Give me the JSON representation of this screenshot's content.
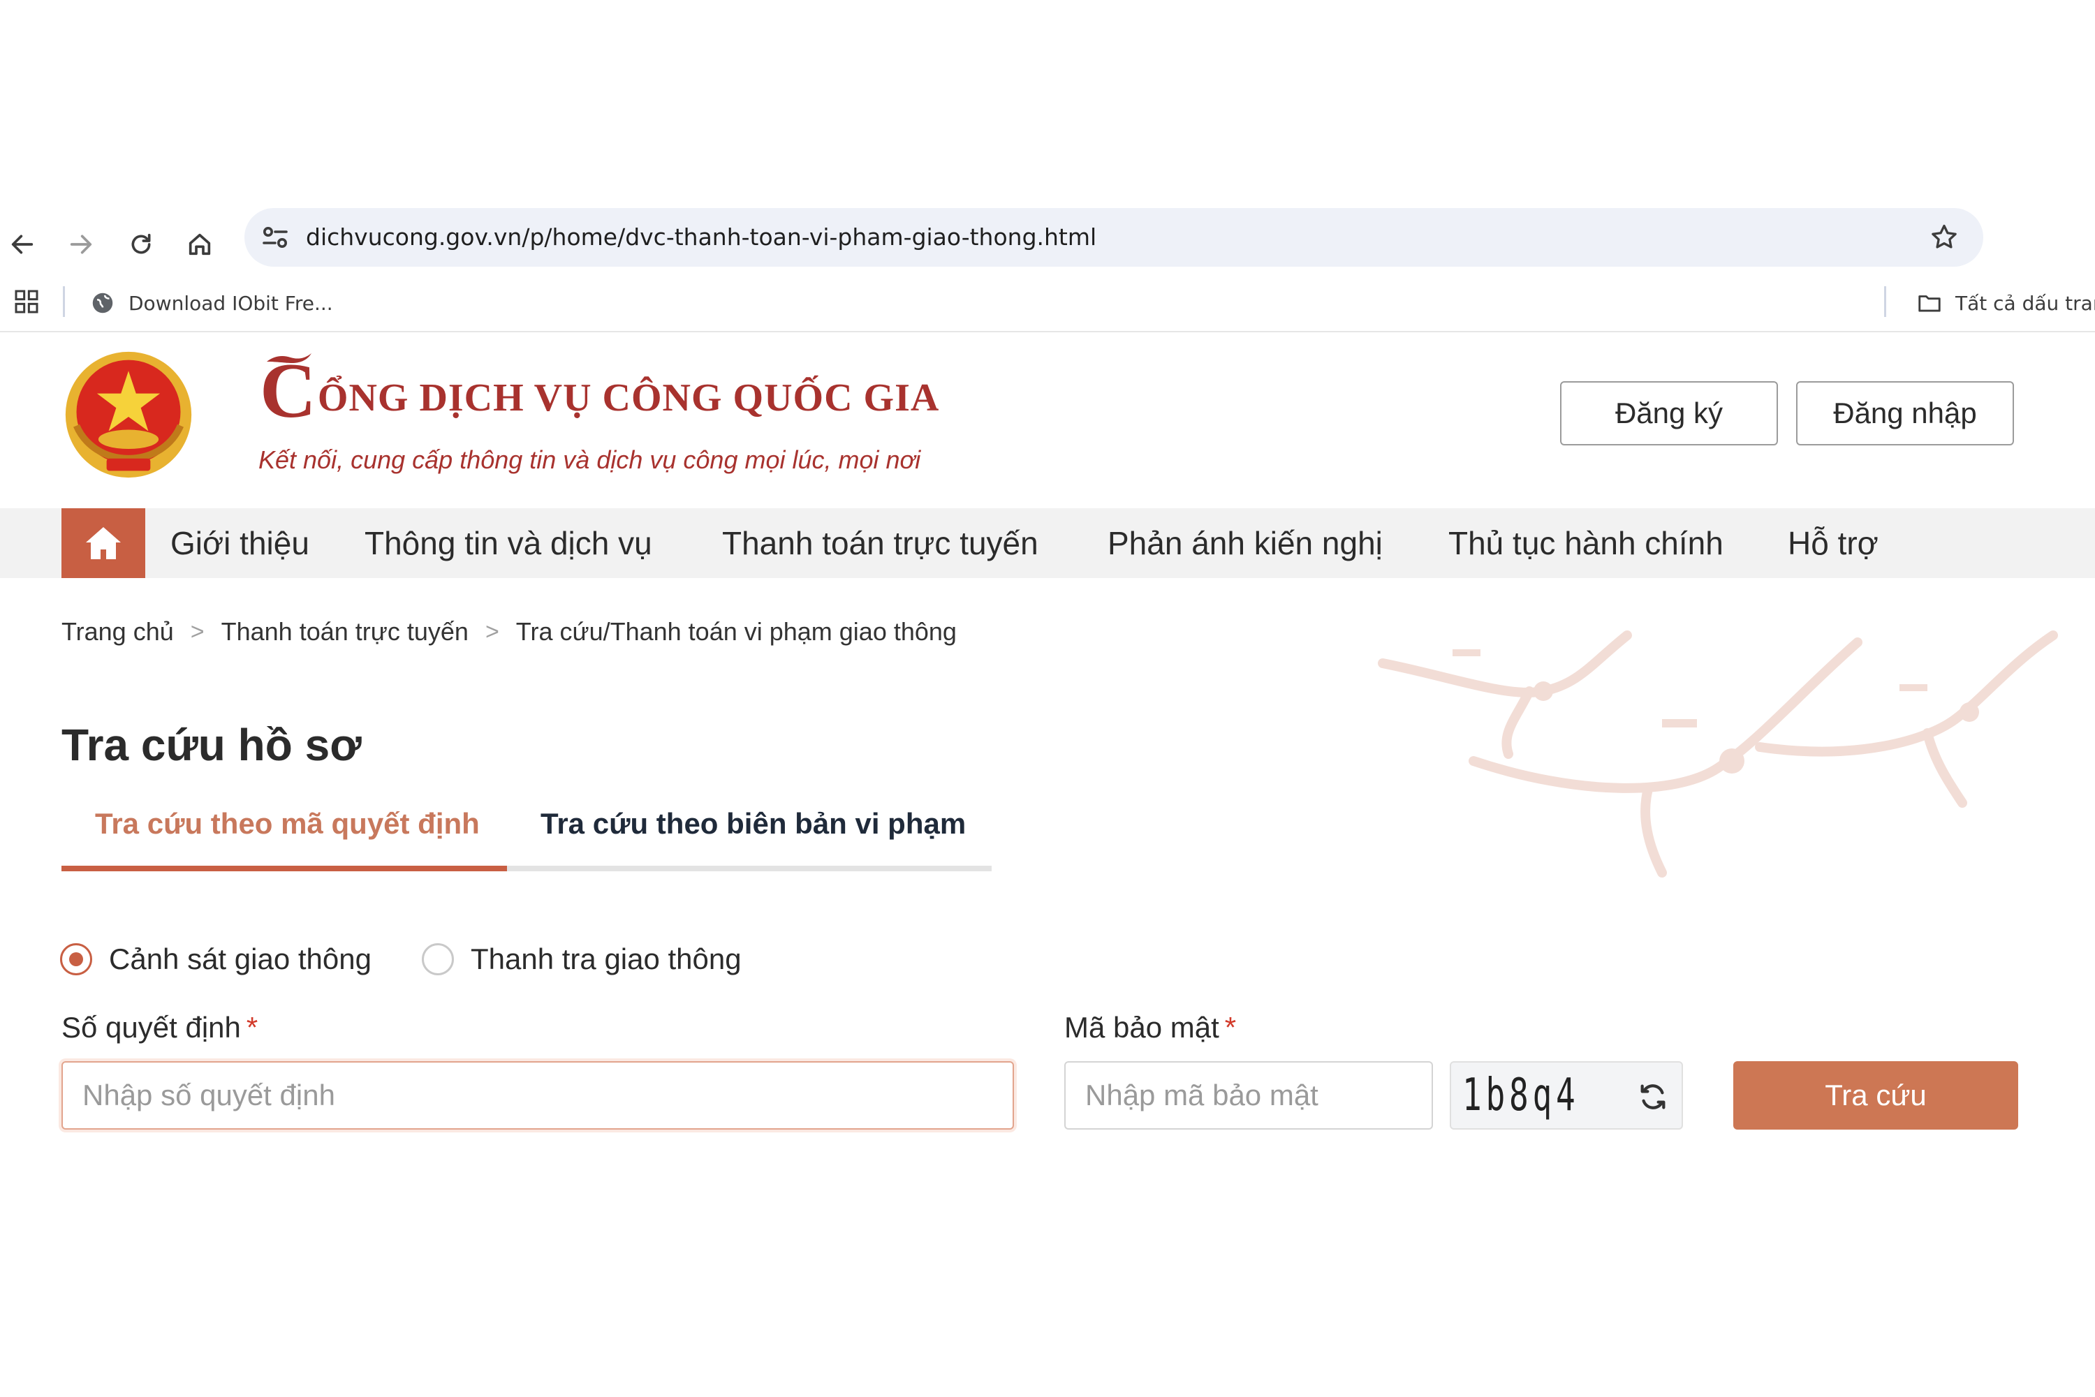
{
  "browser": {
    "url": "dichvucong.gov.vn/p/home/dvc-thanh-toan-vi-pham-giao-thong.html",
    "bookmark_1": "Download IObit Fre...",
    "bookmark_all": "Tất cả dấu trang",
    "icons": [
      "back-icon",
      "forward-icon",
      "reload-icon",
      "home-icon",
      "site-info-icon",
      "star-icon",
      "apps-icon",
      "globe-icon",
      "folder-icon"
    ]
  },
  "header": {
    "logo_initial": "C",
    "logo_title_rest": "ỔNG DỊCH VỤ CÔNG QUỐC GIA",
    "slogan": "Kết nối, cung cấp thông tin và dịch vụ công mọi lúc, mọi nơi",
    "register_label": "Đăng ký",
    "login_label": "Đăng nhập",
    "brand_color": "#a8322e"
  },
  "nav": {
    "items": [
      {
        "label": "Giới thiệu"
      },
      {
        "label": "Thông tin và dịch vụ"
      },
      {
        "label": "Thanh toán trực tuyến"
      },
      {
        "label": "Phản ánh kiến nghị"
      },
      {
        "label": "Thủ tục hành chính"
      },
      {
        "label": "Hỗ trợ"
      }
    ],
    "accent_color": "#c85f43"
  },
  "breadcrumb": {
    "separator": ">",
    "items": [
      "Trang chủ",
      "Thanh toán trực tuyến",
      "Tra cứu/Thanh toán vi phạm giao thông"
    ]
  },
  "page": {
    "title": "Tra cứu hồ sơ",
    "tabs": [
      {
        "label": "Tra cứu theo mã quyết định",
        "active": true
      },
      {
        "label": "Tra cứu theo biên bản vi phạm",
        "active": false
      }
    ],
    "radios": [
      {
        "label": "Cảnh sát giao thông",
        "checked": true
      },
      {
        "label": "Thanh tra giao thông",
        "checked": false
      }
    ],
    "decision_label": "Số quyết định",
    "decision_placeholder": "Nhập số quyết định",
    "required_mark": "*",
    "captcha_label": "Mã bảo mật",
    "captcha_placeholder": "Nhập mã bảo mật",
    "captcha_code": "1b8q4",
    "search_label": "Tra cứu",
    "button_color": "#cd7754"
  }
}
